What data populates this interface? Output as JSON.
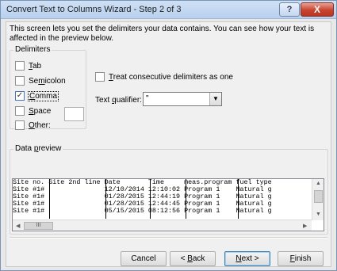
{
  "window": {
    "title": "Convert Text to Columns Wizard - Step 2 of 3",
    "help_label": "?",
    "close_label": "X"
  },
  "instructions": "This screen lets you set the delimiters your data contains.  You can see how your text is affected in the preview below.",
  "delimiters": {
    "group_label": "Delimiters",
    "items": [
      {
        "key": "T",
        "rest": "ab",
        "pre": "",
        "checked": false
      },
      {
        "key": "m",
        "rest": "icolon",
        "pre": "Se",
        "checked": false
      },
      {
        "key": "C",
        "rest": "omma",
        "pre": "",
        "checked": true
      },
      {
        "key": "S",
        "rest": "pace",
        "pre": "",
        "checked": false
      },
      {
        "key": "O",
        "rest": "ther:",
        "pre": "",
        "checked": false
      }
    ],
    "other_value": ""
  },
  "consecutive": {
    "pre": "",
    "key": "T",
    "rest": "reat consecutive delimiters as one",
    "checked": false
  },
  "qualifier": {
    "pre": "Text ",
    "key": "q",
    "rest": "ualifier:",
    "value": "\""
  },
  "preview": {
    "group_pre": "Data ",
    "group_key": "p",
    "group_rest": "review",
    "rows": [
      [
        "Site no.",
        "Site 2nd line",
        "Date",
        "Time",
        "meas.program",
        "fuel type"
      ],
      [
        "Site #1#",
        "",
        "12/10/2014",
        "12:10:02",
        "Program 1",
        "Natural g"
      ],
      [
        "Site #1#",
        "",
        "01/28/2015",
        "12:44:19",
        "Program 1",
        "Natural g"
      ],
      [
        "Site #1#",
        "",
        "01/28/2015",
        "12:44:45",
        "Program 1",
        "Natural g"
      ],
      [
        "Site #1#",
        "",
        "05/15/2015",
        "08:12:56",
        "Program 1",
        "Natural g"
      ]
    ],
    "hscroll_thumb": "III",
    "up_arrow": "▲",
    "down_arrow": "▼",
    "left_arrow": "◀",
    "right_arrow": "▶"
  },
  "buttons": {
    "cancel": "Cancel",
    "back_pre": "< ",
    "back_key": "B",
    "back_rest": "ack",
    "next_key": "N",
    "next_rest": "ext >",
    "finish_key": "F",
    "finish_rest": "inish"
  }
}
